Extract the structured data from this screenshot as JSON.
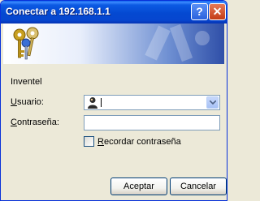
{
  "window": {
    "title": "Conectar a 192.168.1.1",
    "help_button": "?",
    "close_button": "✕"
  },
  "dialog": {
    "server_name": "Inventel",
    "user_label_u": "U",
    "user_label_rest": "suario:",
    "password_label_u": "C",
    "password_label_rest": "ontraseña:",
    "remember_label_u": "R",
    "remember_label_rest": "ecordar contraseña",
    "remember_checked": false,
    "user_value": "",
    "password_value": ""
  },
  "buttons": {
    "ok": "Aceptar",
    "cancel": "Cancelar"
  },
  "icons": {
    "banner": "keys-icon",
    "user": "user-icon"
  }
}
